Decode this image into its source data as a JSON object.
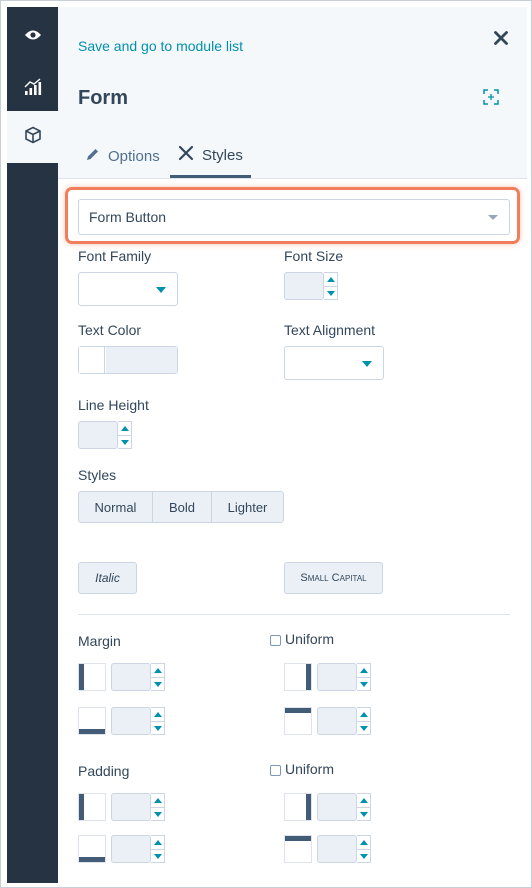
{
  "rail": {
    "items": [
      {
        "name": "preview-eye-icon"
      },
      {
        "name": "analytics-chart-icon"
      },
      {
        "name": "module-cube-icon",
        "active": true
      }
    ]
  },
  "header": {
    "back_link": "Save and go to module list",
    "title": "Form"
  },
  "tabs": [
    {
      "label": "Options"
    },
    {
      "label": "Styles",
      "active": true
    }
  ],
  "element_select": {
    "value": "Form Button"
  },
  "fields": {
    "font_family": "Font Family",
    "font_size": "Font Size",
    "text_color": "Text Color",
    "text_alignment": "Text Alignment",
    "line_height": "Line Height",
    "styles": "Styles"
  },
  "style_buttons": [
    "Normal",
    "Bold",
    "Lighter"
  ],
  "italic_button": "Italic",
  "small_capital_button": "Small Capital",
  "margin": {
    "label": "Margin",
    "uniform_label": "Uniform",
    "uniform_checked": false
  },
  "padding": {
    "label": "Padding",
    "uniform_label": "Uniform",
    "uniform_checked": false
  },
  "colors": {
    "highlight": "#f07d5c",
    "accent": "#0091ae",
    "rail": "#253342",
    "text": "#33475b"
  }
}
